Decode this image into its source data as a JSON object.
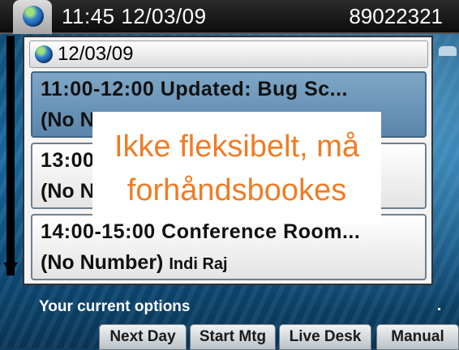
{
  "status_bar": {
    "datetime": "11:45 12/03/09",
    "phone_number": "89022321",
    "icon": "globe-icon"
  },
  "calendar": {
    "date": "12/03/09",
    "appointments": [
      {
        "line1": "11:00-12:00 Updated: Bug Sc...",
        "line2": "(No Number)",
        "owner": "",
        "selected": true
      },
      {
        "line1": "13:00-14:00 Conference Room...",
        "line2": "(No Number)",
        "owner": "",
        "selected": false
      },
      {
        "line1": "14:00-15:00 Conference Room...",
        "line2": "(No Number)",
        "owner": "Indi Raj",
        "selected": false
      }
    ]
  },
  "callout": {
    "line1": "Ikke fleksibelt, må",
    "line2": "forhåndsbookes"
  },
  "options": {
    "label": "Your current options",
    "softkeys": [
      "Next Day",
      "Start Mtg",
      "Live Desk",
      "Manual"
    ]
  }
}
